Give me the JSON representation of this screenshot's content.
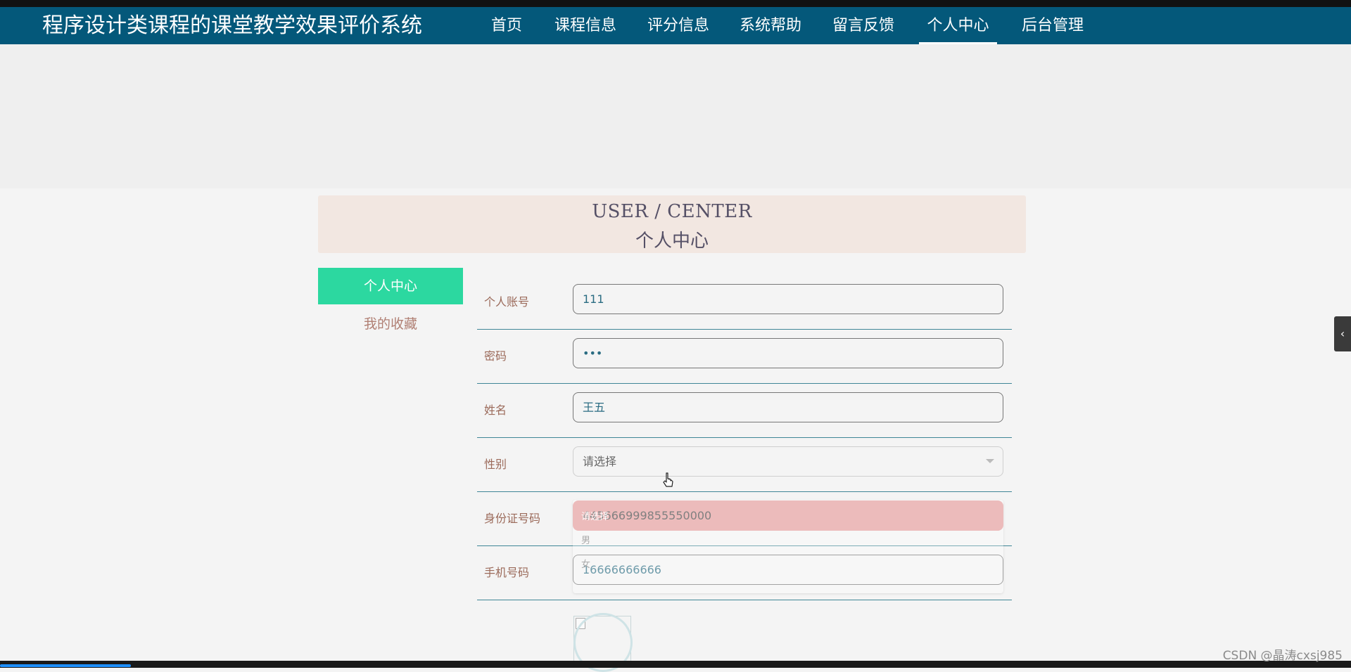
{
  "site_title": "程序设计类课程的课堂教学效果评价系统",
  "nav": [
    "首页",
    "课程信息",
    "评分信息",
    "系统帮助",
    "留言反馈",
    "个人中心",
    "后台管理"
  ],
  "nav_active": "个人中心",
  "section_header": {
    "english": "USER / CENTER",
    "chinese": "个人中心"
  },
  "sidebar": {
    "active": "个人中心",
    "items": [
      "我的收藏"
    ]
  },
  "form": {
    "account": {
      "label": "个人账号",
      "value": "111"
    },
    "password": {
      "label": "密码",
      "value": "•••"
    },
    "name": {
      "label": "姓名",
      "value": "王五"
    },
    "gender": {
      "label": "性别",
      "value": "请选择",
      "options": [
        "请选择",
        "男",
        "女"
      ]
    },
    "id_card": {
      "label": "身份证号码",
      "value": "445666999855550000"
    },
    "phone": {
      "label": "手机号码",
      "value": "16666666666"
    }
  },
  "side_tab_icon": "‹",
  "watermark": "CSDN @晶涛cxsj985",
  "icons": [
    "dropdown-caret-icon",
    "broken-image-icon",
    "pointer-cursor-icon",
    "chevron-left-icon"
  ],
  "colors": {
    "navbar": "#04587a",
    "sidebar_active": "#2cd8a0",
    "header_box": "#f2e7e1",
    "row_divider": "#3f8696",
    "invalid_field": "#e39b9b"
  }
}
